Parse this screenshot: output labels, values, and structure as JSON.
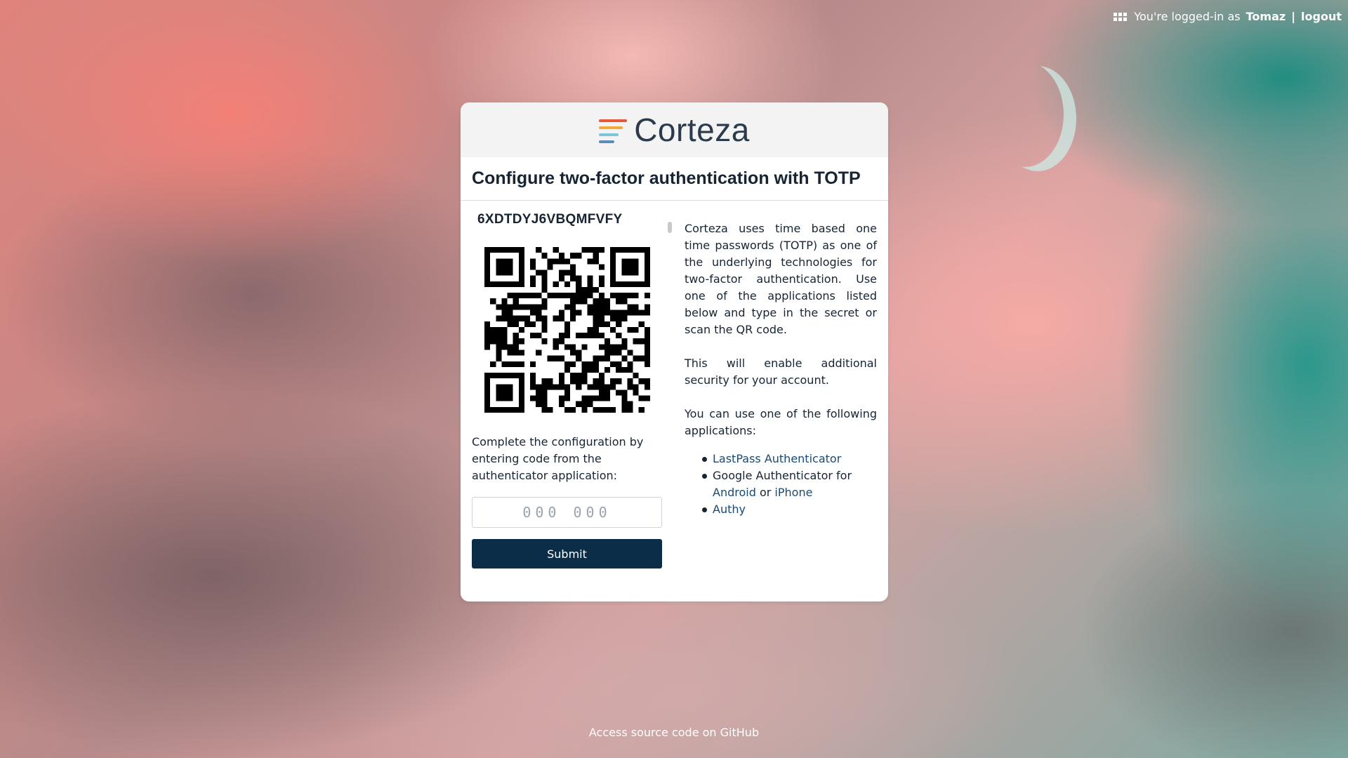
{
  "topbar": {
    "prefix": "You're logged-in as",
    "username": "Tomaz",
    "separator": "|",
    "logout": "logout",
    "icon": "apps-grid-icon"
  },
  "brand": {
    "name": "Corteza",
    "stripe_colors": [
      "#e4593a",
      "#f2a93b",
      "#7cc4d6",
      "#5b8db8"
    ]
  },
  "page": {
    "title": "Configure two-factor authentication with TOTP"
  },
  "totp": {
    "secret": "6XDTDYJ6VBQMFVFY",
    "instructions": "Complete the configuration by entering code from the authenticator application:",
    "code_placeholder": "000 000",
    "code_value": "",
    "submit_label": "Submit"
  },
  "info": {
    "paragraph1": "Corteza uses time based one time passwords (TOTP) as one of the underlying technologies for two-factor authentication. Use one of the applications listed below and type in the secret or scan the QR code.",
    "paragraph2": "This will enable additional security for your account.",
    "paragraph3": "You can use one of the following applications:",
    "apps": {
      "lastpass": "LastPass Authenticator",
      "google_prefix": "Google Authenticator for",
      "android": "Android",
      "or": "or",
      "iphone": "iPhone",
      "authy": "Authy"
    }
  },
  "footer": {
    "text": "Access source code on",
    "link": "GitHub"
  },
  "colors": {
    "primary": "#0c2d48",
    "link": "#1a4a72",
    "text": "#162433"
  }
}
